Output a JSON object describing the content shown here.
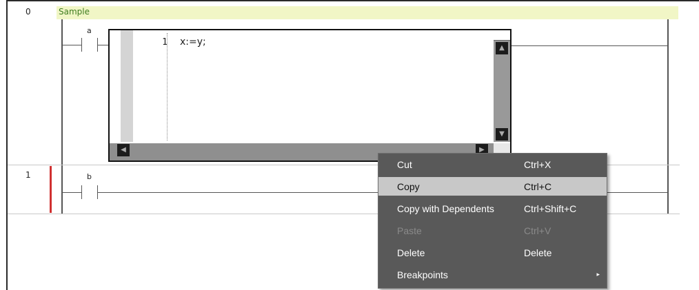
{
  "rungs": [
    {
      "number": "0",
      "comment": "Sample",
      "contact_label": "a"
    },
    {
      "number": "1",
      "contact_label": "b"
    }
  ],
  "st_editor": {
    "line_number": "1",
    "code": "x:=y;"
  },
  "context_menu": {
    "items": [
      {
        "label": "Cut",
        "shortcut": "Ctrl+X",
        "state": "normal"
      },
      {
        "label": "Copy",
        "shortcut": "Ctrl+C",
        "state": "highlighted"
      },
      {
        "label": "Copy with Dependents",
        "shortcut": "Ctrl+Shift+C",
        "state": "normal"
      },
      {
        "label": "Paste",
        "shortcut": "Ctrl+V",
        "state": "disabled"
      },
      {
        "label": "Delete",
        "shortcut": "Delete",
        "state": "normal"
      },
      {
        "label": "Breakpoints",
        "shortcut": "",
        "state": "submenu",
        "arrow": "▸"
      }
    ]
  },
  "colors": {
    "comment_bg": "#f1f6c6",
    "comment_text": "#3f7d1f",
    "rung_marker": "#d03030",
    "menu_bg": "#595959",
    "menu_highlight": "#c8c8c8"
  }
}
